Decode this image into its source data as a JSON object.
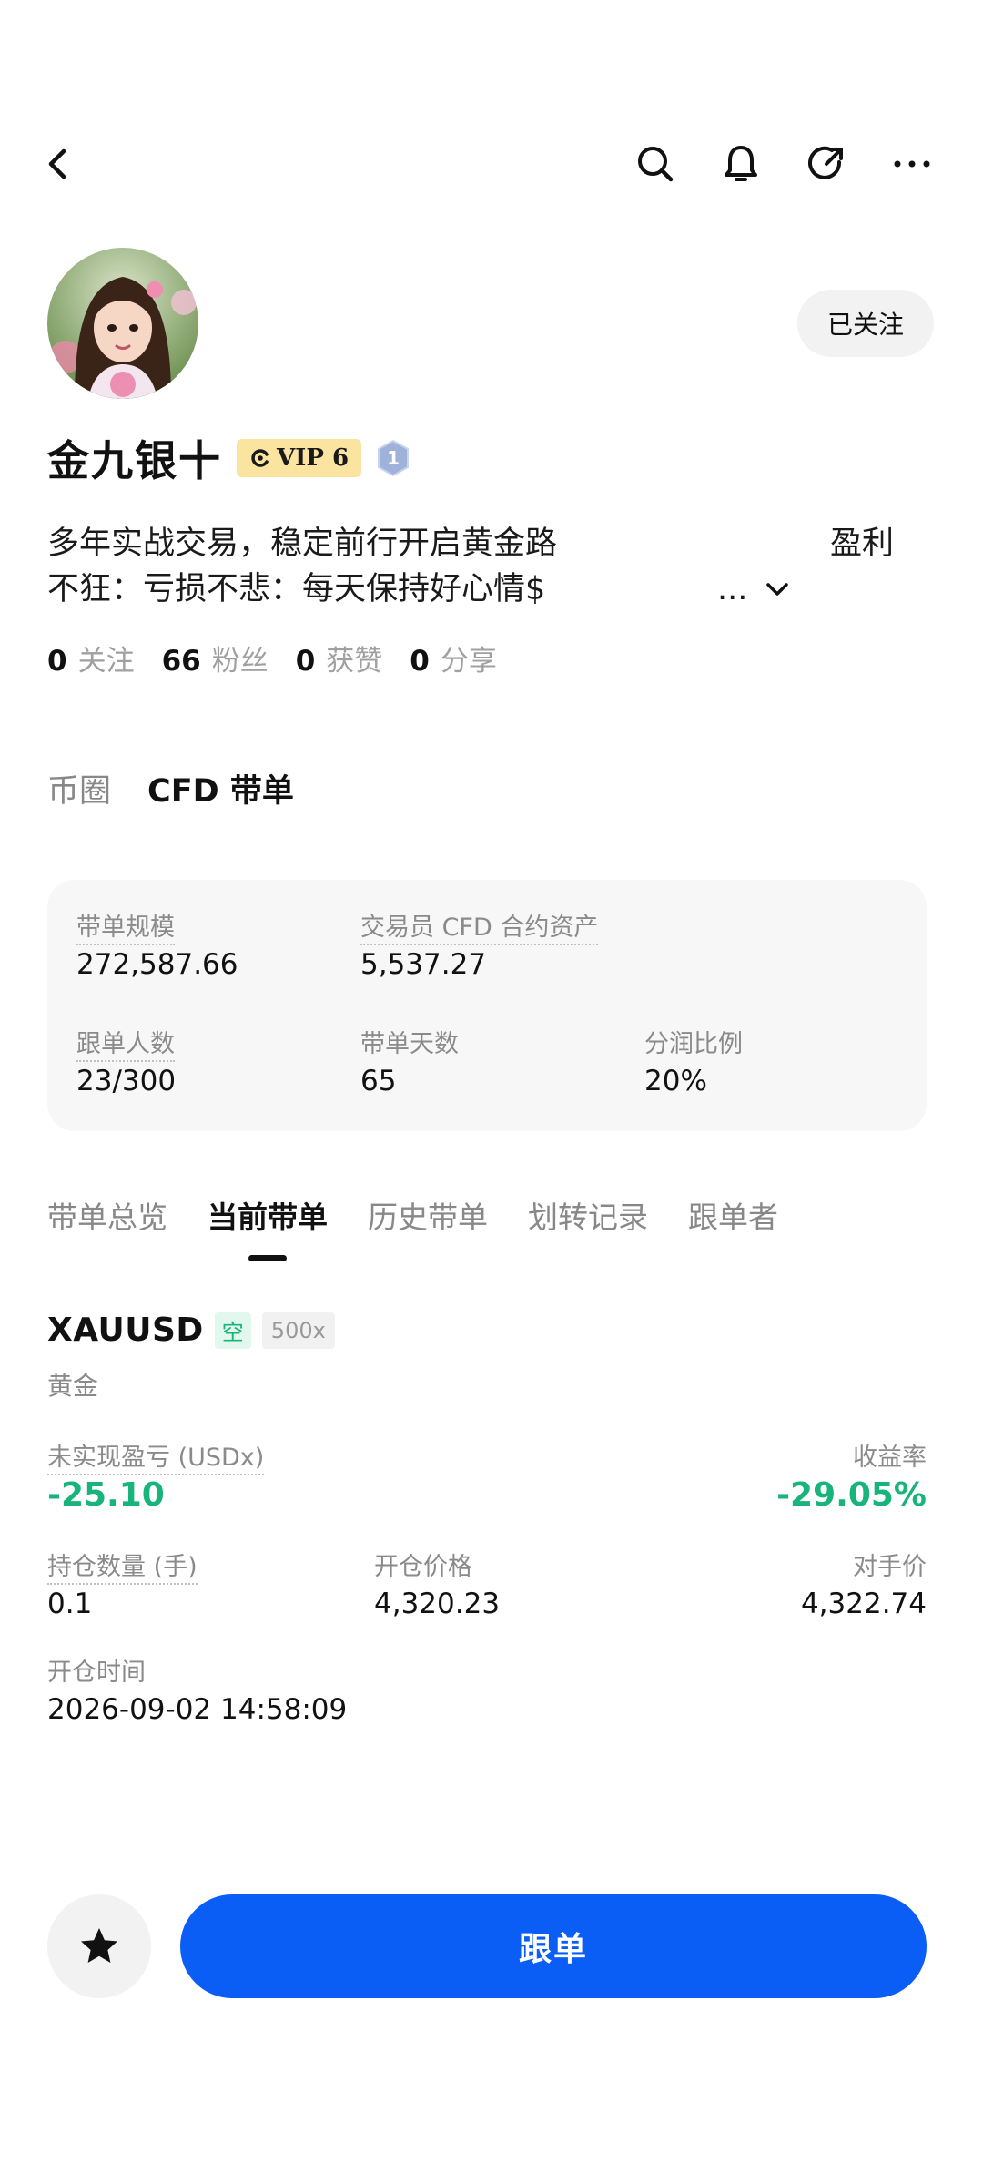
{
  "header": {
    "icons": [
      "back-arrow-icon",
      "search-icon",
      "bell-icon",
      "share-icon",
      "more-icon"
    ]
  },
  "profile": {
    "name": "金九银十",
    "vip_label": "VIP 6",
    "level": "1",
    "follow_button": "已关注",
    "bio_line1": "多年实战交易，稳定前行开启黄金路",
    "bio_line1_right": "盈利",
    "bio_line2": "不狂：亏损不悲：每天保持好心情$",
    "bio_more": "...",
    "stats": [
      {
        "value": "0",
        "label": "关注"
      },
      {
        "value": "66",
        "label": "粉丝"
      },
      {
        "value": "0",
        "label": "获赞"
      },
      {
        "value": "0",
        "label": "分享"
      }
    ]
  },
  "category_tabs": [
    {
      "label": "币圈",
      "active": false
    },
    {
      "label": "CFD 带单",
      "active": true
    }
  ],
  "summary": {
    "scale_label": "带单规模",
    "scale_value": "272,587.66",
    "assets_label": "交易员 CFD 合约资产",
    "assets_value": "5,537.27",
    "followers_label": "跟单人数",
    "followers_value": "23/300",
    "days_label": "带单天数",
    "days_value": "65",
    "share_label": "分润比例",
    "share_value": "20%"
  },
  "sub_tabs": [
    {
      "label": "带单总览",
      "active": false
    },
    {
      "label": "当前带单",
      "active": true
    },
    {
      "label": "历史带单",
      "active": false
    },
    {
      "label": "划转记录",
      "active": false
    },
    {
      "label": "跟单者",
      "active": false
    }
  ],
  "position": {
    "symbol": "XAUUSD",
    "direction": "空",
    "leverage": "500x",
    "name": "黄金",
    "pnl_label": "未实现盈亏 (USDx)",
    "pnl_value": "-25.10",
    "roi_label": "收益率",
    "roi_value": "-29.05%",
    "qty_label": "持仓数量 (手)",
    "qty_value": "0.1",
    "open_price_label": "开仓价格",
    "open_price_value": "4,320.23",
    "counter_price_label": "对手价",
    "counter_price_value": "4,322.74",
    "open_time_label": "开仓时间",
    "open_time_value": "2026-09-02 14:58:09"
  },
  "bottom": {
    "follow_order_button": "跟单"
  },
  "colors": {
    "accent_blue": "#0a5ef5",
    "profit_green": "#18b47b",
    "vip_gold": "#fbe3a0"
  }
}
